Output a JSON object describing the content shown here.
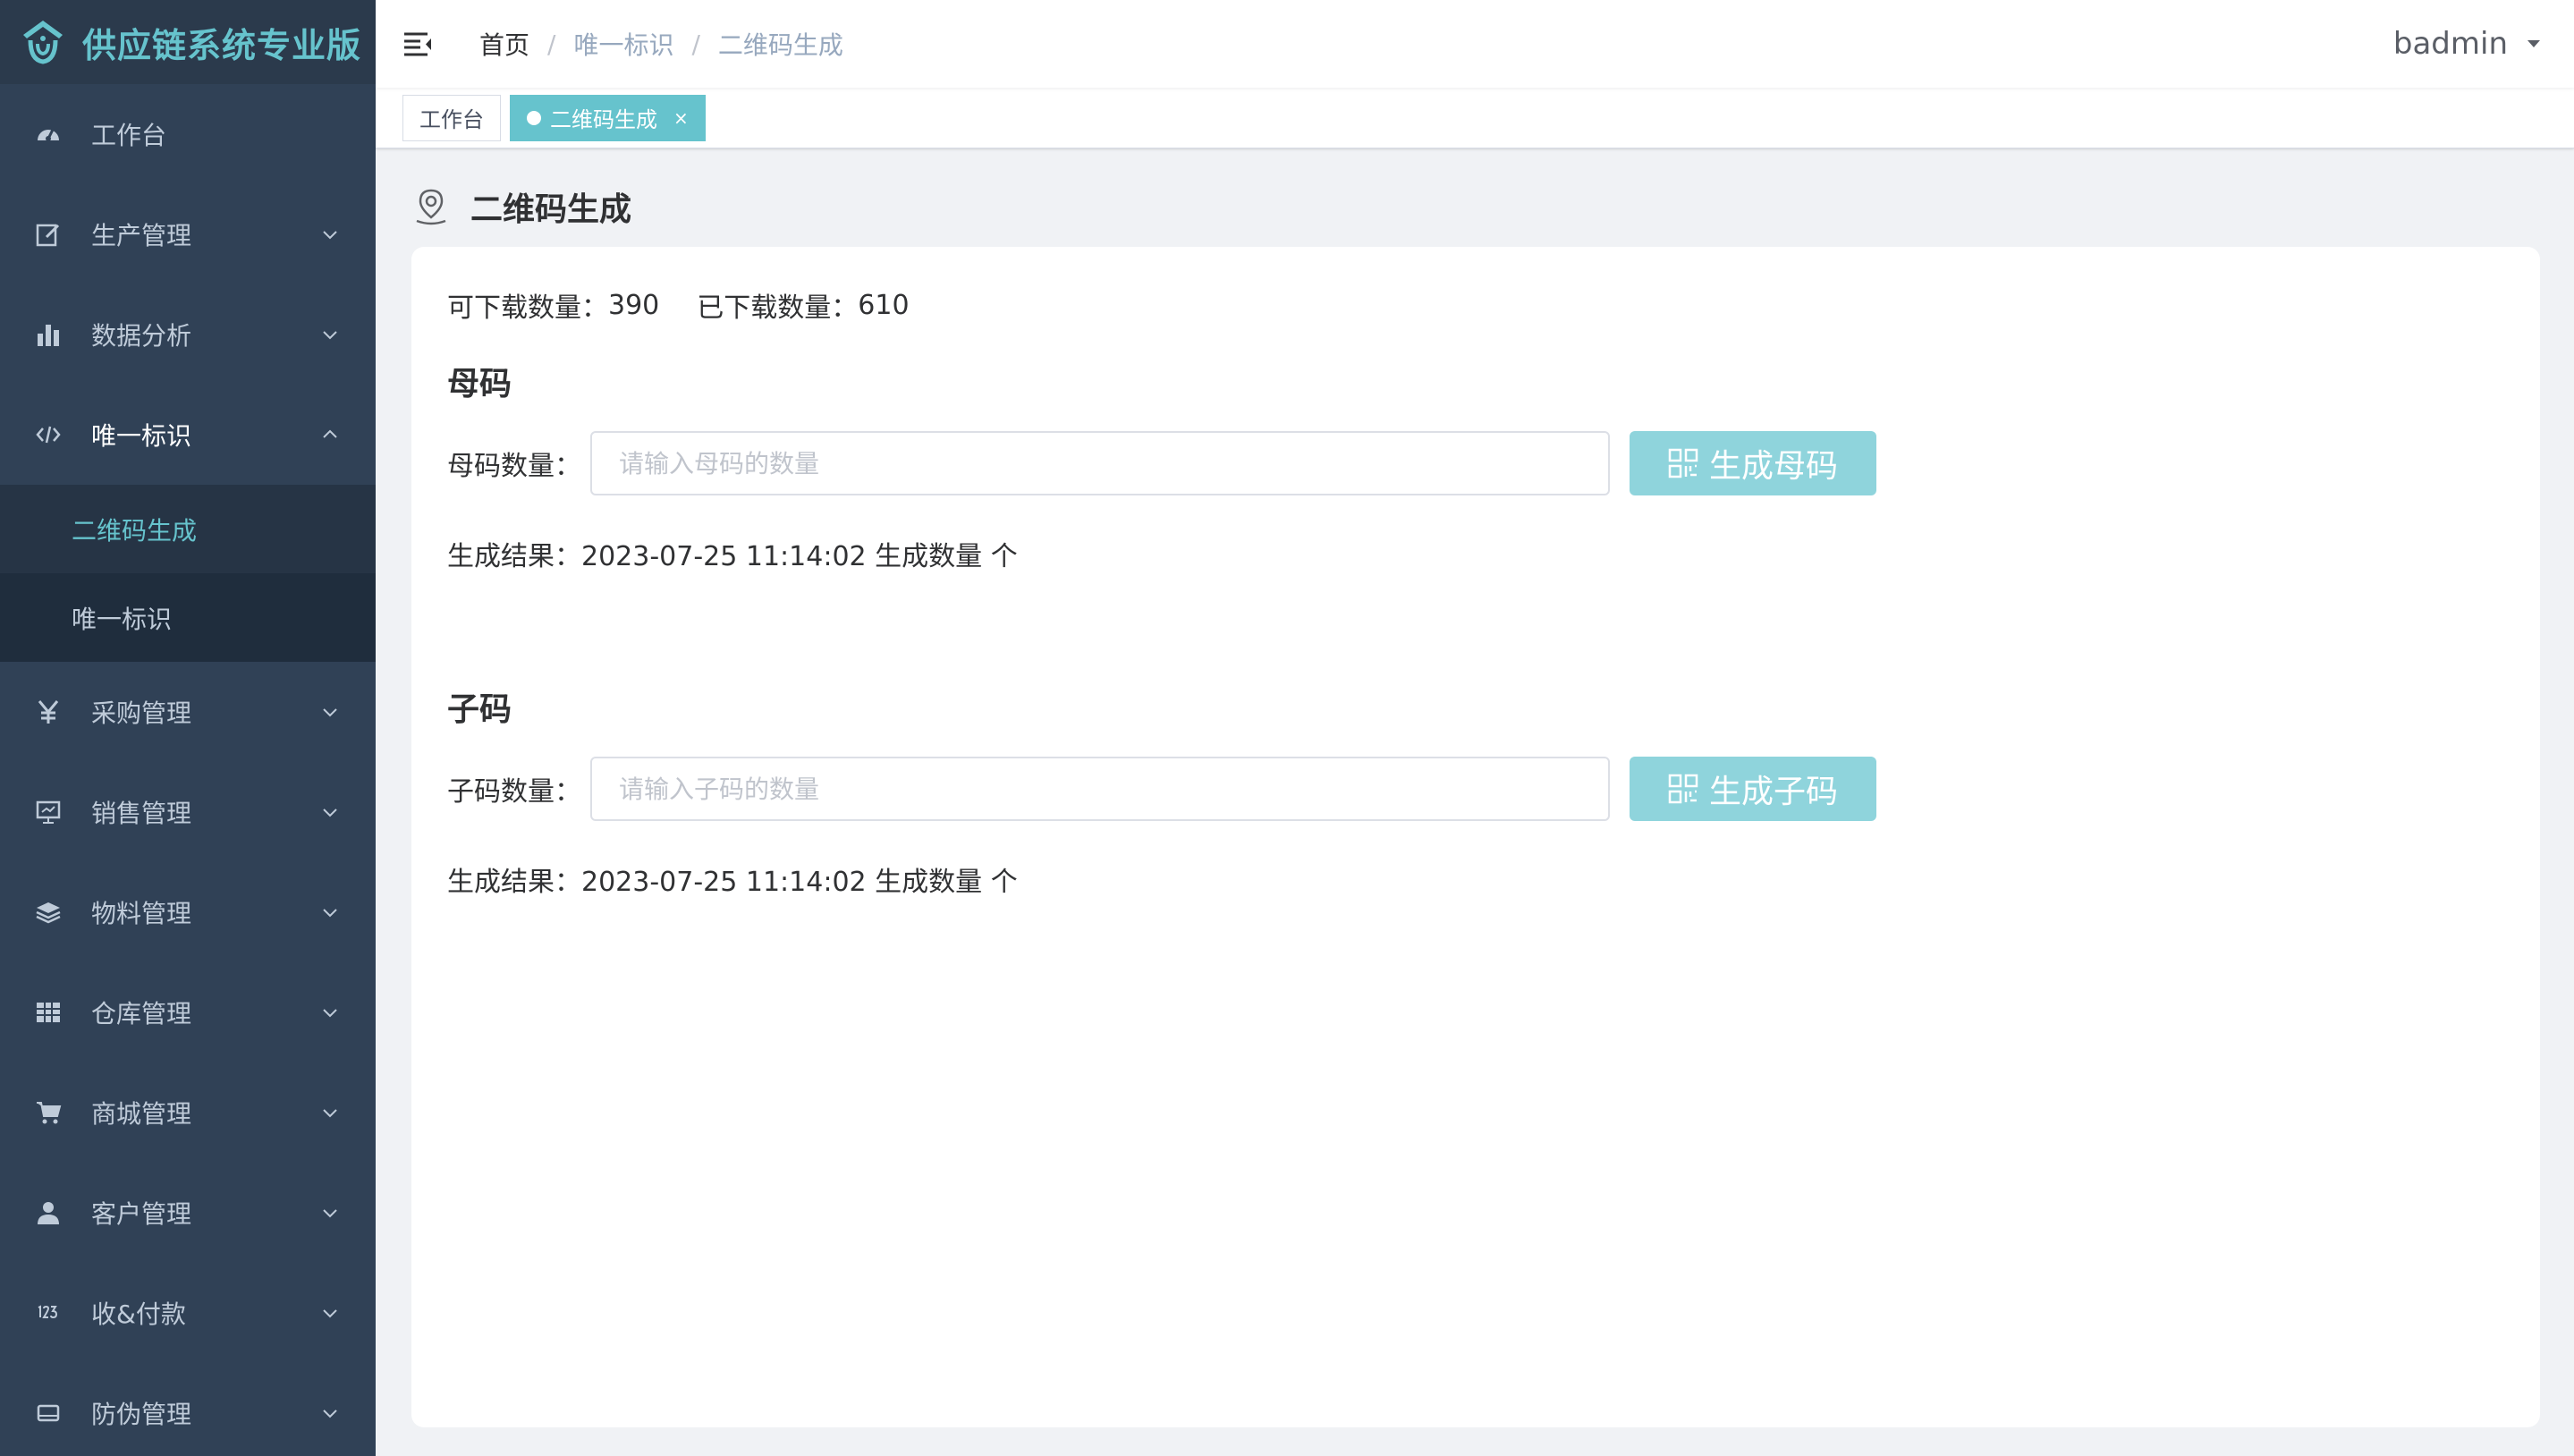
{
  "brand": {
    "title": "供应链系统专业版"
  },
  "sidebar": {
    "items": [
      {
        "label": "工作台",
        "icon": "dashboard-icon"
      },
      {
        "label": "生产管理",
        "icon": "edit-icon"
      },
      {
        "label": "数据分析",
        "icon": "bar-chart-icon"
      },
      {
        "label": "唯一标识",
        "icon": "code-icon",
        "expanded": true,
        "children": [
          {
            "label": "二维码生成",
            "active": true
          },
          {
            "label": "唯一标识"
          }
        ]
      },
      {
        "label": "采购管理",
        "icon": "yen-icon"
      },
      {
        "label": "销售管理",
        "icon": "monitor-icon"
      },
      {
        "label": "物料管理",
        "icon": "layers-icon"
      },
      {
        "label": "仓库管理",
        "icon": "table-icon"
      },
      {
        "label": "商城管理",
        "icon": "cart-icon"
      },
      {
        "label": "客户管理",
        "icon": "user-icon"
      },
      {
        "label": "收&付款",
        "icon": "number-icon"
      },
      {
        "label": "防伪管理",
        "icon": "card-icon"
      }
    ]
  },
  "header": {
    "breadcrumb": [
      "首页",
      "唯一标识",
      "二维码生成"
    ],
    "separator": "/",
    "username": "badmin"
  },
  "tags": [
    {
      "label": "工作台",
      "active": false
    },
    {
      "label": "二维码生成",
      "active": true,
      "close": "×"
    }
  ],
  "page": {
    "title": "二维码生成",
    "stats": {
      "available_label": "可下载数量：",
      "available_value": "390",
      "downloaded_label": "已下载数量：",
      "downloaded_value": "610"
    },
    "parent": {
      "section_title": "母码",
      "label": "母码数量：",
      "placeholder": "请输入母码的数量",
      "button": "生成母码",
      "result_label": "生成结果：",
      "result_value": "2023-07-25 11:14:02 生成数量 个"
    },
    "child": {
      "section_title": "子码",
      "label": "子码数量：",
      "placeholder": "请输入子码的数量",
      "button": "生成子码",
      "result_label": "生成结果：",
      "result_value": "2023-07-25 11:14:02 生成数量 个"
    }
  },
  "colors": {
    "sidebar_bg": "#304156",
    "accent": "#66c3cd",
    "button": "#8fd4dc",
    "content_bg": "#f0f2f5"
  }
}
